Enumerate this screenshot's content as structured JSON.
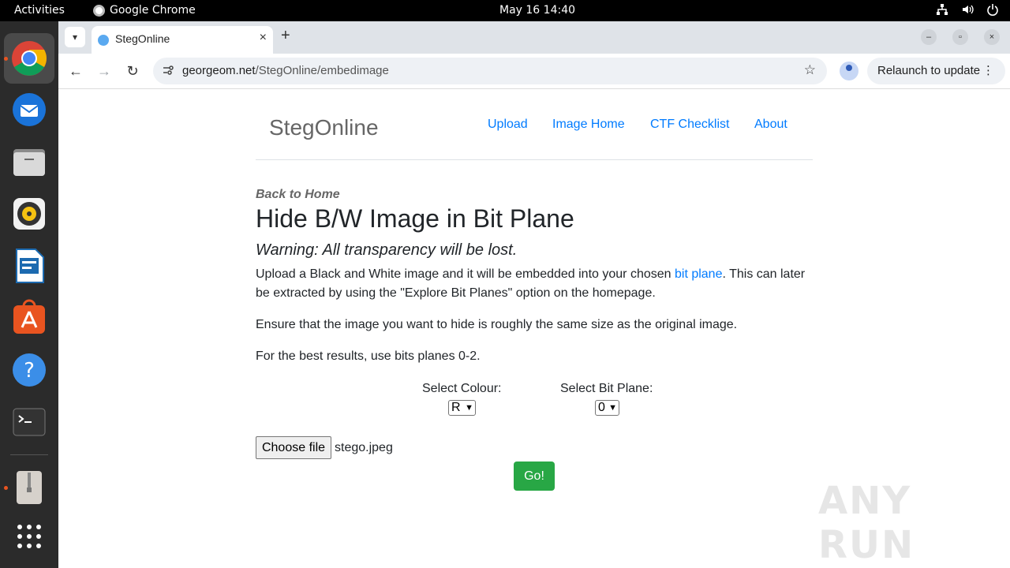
{
  "topbar": {
    "activities": "Activities",
    "app_name": "Google Chrome",
    "clock": "May 16  14:40"
  },
  "browser": {
    "tab_title": "StegOnline",
    "url_host": "georgeom.net",
    "url_path": "/StegOnline/embedimage",
    "relaunch_label": "Relaunch to update"
  },
  "site": {
    "brand": "StegOnline",
    "nav": [
      "Upload",
      "Image Home",
      "CTF Checklist",
      "About"
    ]
  },
  "content": {
    "back_link": "Back to Home",
    "heading": "Hide B/W Image in Bit Plane",
    "warning": "Warning: All transparency will be lost.",
    "para1_before": "Upload a Black and White image and it will be embedded into your chosen ",
    "para1_link": "bit plane",
    "para1_after": ". This can later be extracted by using the \"Explore Bit Planes\" option on the homepage.",
    "para2": "Ensure that the image you want to hide is roughly the same size as the original image.",
    "para3": "For the best results, use bits planes 0-2.",
    "colour_label": "Select Colour:",
    "colour_value": "R",
    "bitplane_label": "Select Bit Plane:",
    "bitplane_value": "0",
    "choose_file_label": "Choose file",
    "file_name": "stego.jpeg",
    "go_label": "Go!"
  },
  "watermark": "ANY RUN",
  "colors": {
    "link": "#007bff",
    "go_button": "#28a745",
    "dock_bg": "#2b2b2b"
  }
}
